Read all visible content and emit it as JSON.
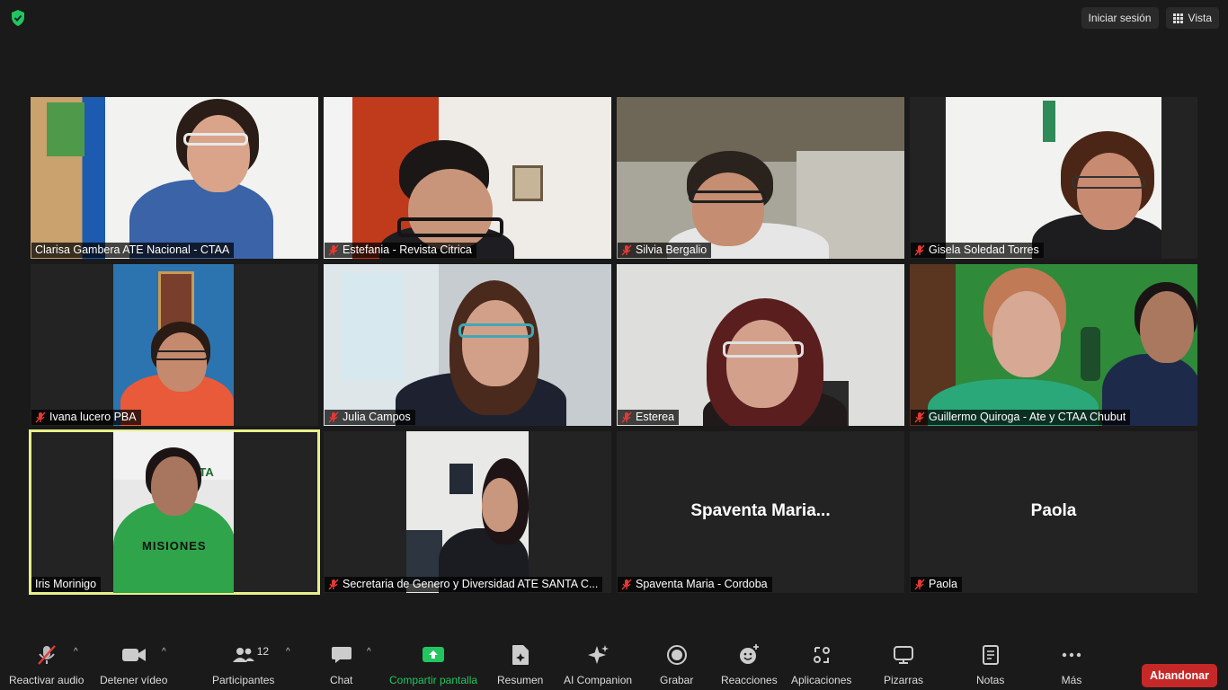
{
  "header": {
    "signin_label": "Iniciar sesión",
    "view_label": "Vista"
  },
  "participants": [
    {
      "name": "Clarisa Gambera ATE Nacional - CTAA",
      "muted": false
    },
    {
      "name": "Estefania - Revista Citrica",
      "muted": true
    },
    {
      "name": "Silvia Bergalio",
      "muted": true
    },
    {
      "name": "Gisela Soledad Torres",
      "muted": true
    },
    {
      "name": "Ivana lucero PBA",
      "muted": true
    },
    {
      "name": "Julia Campos",
      "muted": true
    },
    {
      "name": "Esterea",
      "muted": true
    },
    {
      "name": "Guillermo Quiroga -  Ate y CTAA Chubut",
      "muted": true
    },
    {
      "name": "Iris Morinigo",
      "muted": false,
      "active_speaker": true
    },
    {
      "name": "Secretaria de Genero y Diversidad ATE SANTA C...",
      "muted": true
    },
    {
      "name": "Spaventa Maria - Cordoba",
      "muted": true,
      "display_name": "Spaventa  Maria..."
    },
    {
      "name": "Paola",
      "muted": true,
      "display_name": "Paola"
    }
  ],
  "video_text": {
    "shirt_text": "MISIONES",
    "logo_text": "CTA"
  },
  "toolbar": {
    "unmute": "Reactivar audio",
    "stop_video": "Detener vídeo",
    "participants": "Participantes",
    "participants_count": "12",
    "chat": "Chat",
    "share": "Compartir pantalla",
    "summary": "Resumen",
    "ai": "AI Companion",
    "record": "Grabar",
    "reactions": "Reacciones",
    "apps": "Aplicaciones",
    "whiteboards": "Pizarras",
    "notes": "Notas",
    "more": "Más",
    "leave": "Abandonar"
  },
  "colors": {
    "background": "#1a1a1a",
    "active_speaker_border": "#e8f08a",
    "share_green": "#22c55e",
    "leave_red": "#c62828",
    "muted_red": "#e53935"
  }
}
